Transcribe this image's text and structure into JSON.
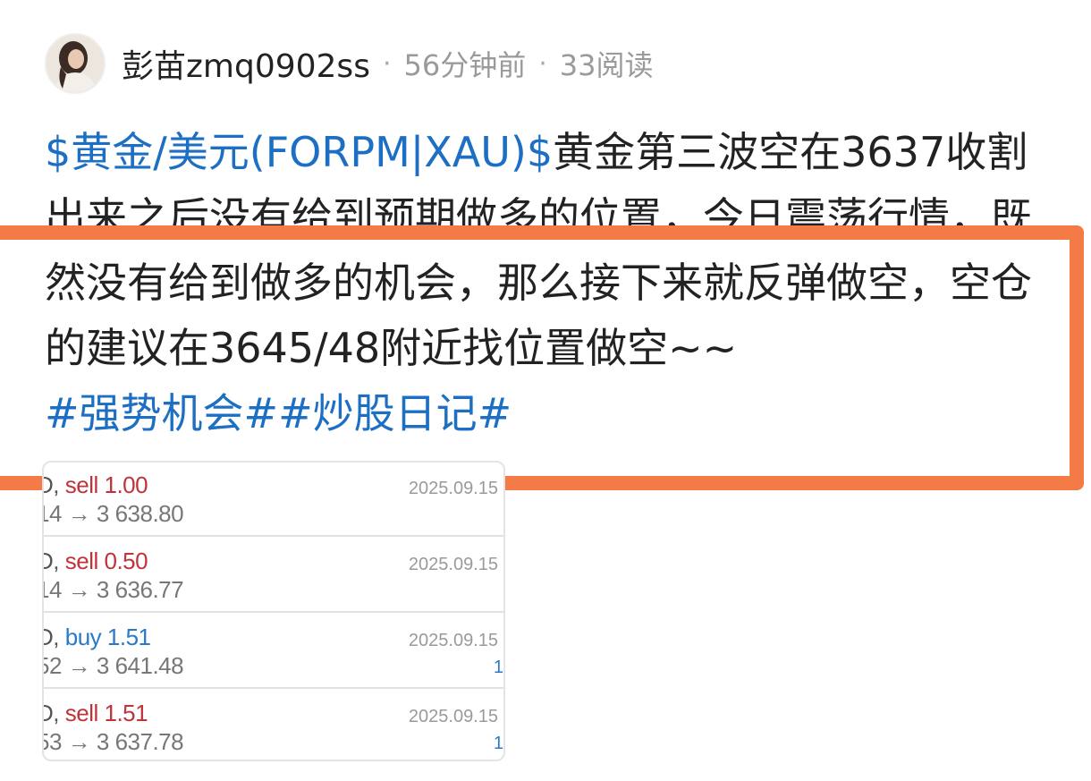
{
  "header": {
    "username": "彭苗zmq0902ss",
    "sep1": "·",
    "time": "56分钟前",
    "sep2": "·",
    "reads": "33阅读"
  },
  "post": {
    "stock_link": "$黄金/美元(FORPM|XAU)$",
    "text": "黄金第三波空在3637收割出来之后没有给到预期做多的位置，今日震荡行情，既然没有给到做多的机会，那么接下来就反弹做空，空仓的建议在3645/48附近找位置做空~~",
    "tag1": "#强势机会#",
    "tag2": "#炒股日记#"
  },
  "highlight": {
    "color": "#f57b46"
  },
  "trades": [
    {
      "symbol_fragment": "D,",
      "side": "sell",
      "lots": "1.00",
      "open_fragment": "14",
      "arrow": "→",
      "close": "3 638.80",
      "date": "2025.09.15",
      "mark": ""
    },
    {
      "symbol_fragment": "D,",
      "side": "sell",
      "lots": "0.50",
      "open_fragment": "14",
      "arrow": "→",
      "close": "3 636.77",
      "date": "2025.09.15",
      "mark": ""
    },
    {
      "symbol_fragment": "D,",
      "side": "buy",
      "lots": "1.51",
      "open_fragment": "52",
      "arrow": "→",
      "close": "3 641.48",
      "date": "2025.09.15",
      "mark": "1"
    },
    {
      "symbol_fragment": "D,",
      "side": "sell",
      "lots": "1.51",
      "open_fragment": "53",
      "arrow": "→",
      "close": "3 637.78",
      "date": "2025.09.15",
      "mark": "1"
    }
  ],
  "colors": {
    "link": "#1d6fc4",
    "sell": "#c0333a",
    "buy": "#2a79c6"
  }
}
